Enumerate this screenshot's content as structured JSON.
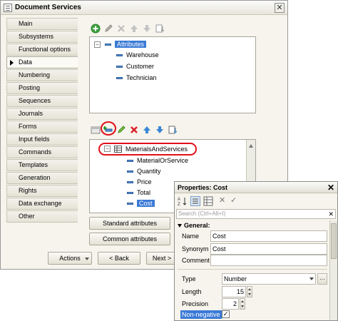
{
  "window": {
    "title": "Document Services",
    "close_glyph": "✕"
  },
  "nav": {
    "items": [
      {
        "label": "Main"
      },
      {
        "label": "Subsystems"
      },
      {
        "label": "Functional options"
      },
      {
        "label": "Data"
      },
      {
        "label": "Numbering"
      },
      {
        "label": "Posting"
      },
      {
        "label": "Sequences"
      },
      {
        "label": "Journals"
      },
      {
        "label": "Forms"
      },
      {
        "label": "Input fields"
      },
      {
        "label": "Commands"
      },
      {
        "label": "Templates"
      },
      {
        "label": "Generation"
      },
      {
        "label": "Rights"
      },
      {
        "label": "Data exchange"
      },
      {
        "label": "Other"
      }
    ],
    "active_index": 3
  },
  "attributes": {
    "root": "Attributes",
    "items": [
      "Warehouse",
      "Customer",
      "Technician"
    ]
  },
  "tabular": {
    "root": "MaterialsAndServices",
    "items": [
      "MaterialOrService",
      "Quantity",
      "Price",
      "Total",
      "Cost"
    ],
    "selected": "Cost"
  },
  "buttons": {
    "standard_attributes": "Standard attributes",
    "common_attributes": "Common attributes",
    "actions": "Actions",
    "back": "< Back",
    "next": "Next >"
  },
  "properties": {
    "title": "Properties: Cost",
    "search_placeholder": "Search (Ctrl+Alt+I)",
    "section_general": "General:",
    "name_label": "Name",
    "name_value": "Cost",
    "synonym_label": "Synonym",
    "synonym_value": "Cost",
    "comment_label": "Comment",
    "comment_value": "",
    "type_label": "Type",
    "type_value": "Number",
    "length_label": "Length",
    "length_value": "15",
    "precision_label": "Precision",
    "precision_value": "2",
    "nonneg_label": "Non-negative",
    "nonneg_checked": true
  },
  "colors": {
    "selection": "#3a7ad6",
    "highlight_ring": "#e0101a"
  }
}
